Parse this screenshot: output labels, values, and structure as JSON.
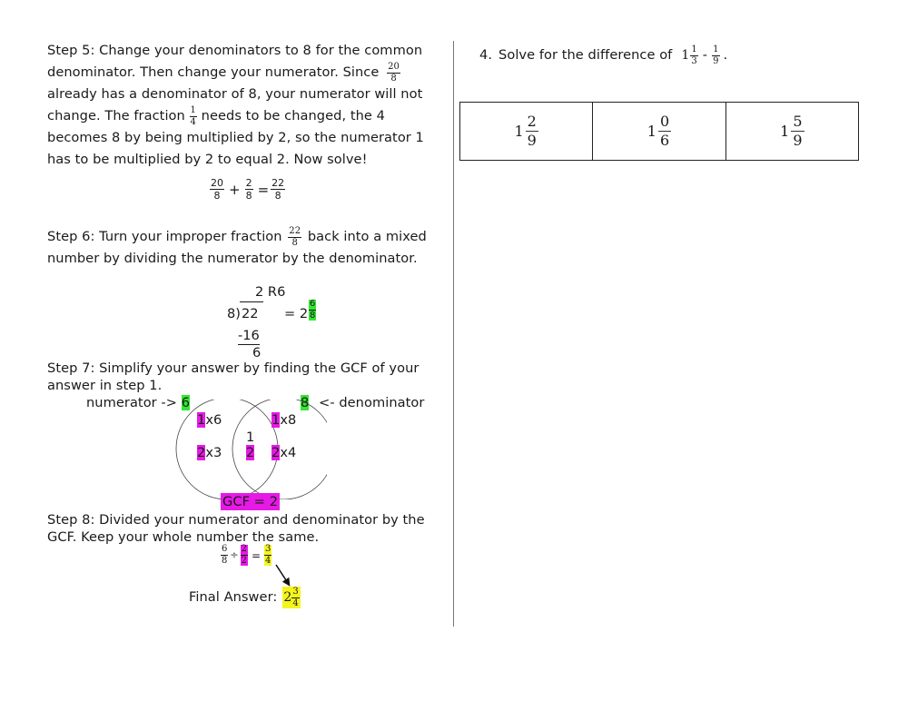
{
  "left_column": {
    "step5": {
      "line1": "Step 5: Change your denominators to 8 for the common",
      "line2_pre": "denominator. Then change your numerator. Since",
      "frac_a": {
        "num": "20",
        "den": "8"
      },
      "line3": "already has a denominator of 8, your numerator will not",
      "line4_pre": "change. The fraction",
      "frac_b": {
        "num": "1",
        "den": "4"
      },
      "line4_post": "needs to be changed, the 4",
      "line5": "becomes 8 by being multiplied by 2, so the numerator 1",
      "line6": "has to be multiplied by 2 to equal 2. Now solve!",
      "equation": {
        "a": {
          "num": "20",
          "den": "8"
        },
        "op1": "+",
        "b": {
          "num": "2",
          "den": "8"
        },
        "op2": "=",
        "c": {
          "num": "22",
          "den": "8"
        }
      }
    },
    "step6": {
      "line1_pre": "Step 6: Turn your improper fraction",
      "frac": {
        "num": "22",
        "den": "8"
      },
      "line1_post": "back into a mixed",
      "line2": "number by dividing the numerator by the denominator.",
      "division": {
        "quotient": "2 R6",
        "divisor": "8)",
        "dividend": "22",
        "equals": "= 2",
        "result_frac": {
          "num": "6",
          "den": "8"
        },
        "subtract": "-16",
        "remainder": "6"
      }
    },
    "step7": {
      "line1": "Step 7: Simplify your answer by finding the GCF of your",
      "line2": "answer in step 1.",
      "numerator_label": "numerator ->",
      "numerator_value": "6",
      "denominator_value": "8",
      "denominator_label": "<- denominator",
      "venn": {
        "left_items": [
          {
            "hl": "1",
            "rest": "x6"
          },
          {
            "hl": "2",
            "rest": "x3"
          }
        ],
        "center_items": [
          {
            "hl": "",
            "rest": "1"
          },
          {
            "hl": "2",
            "rest": ""
          }
        ],
        "right_items": [
          {
            "hl": "1",
            "rest": "x8"
          },
          {
            "hl": "2",
            "rest": "x4"
          }
        ]
      },
      "gcf_label": "GCF = 2"
    },
    "step8": {
      "line1": "Step 8: Divided your numerator and denominator by the",
      "line2": "GCF. Keep your whole number the same.",
      "equation": {
        "a": {
          "num": "6",
          "den": "8"
        },
        "op1": "÷",
        "b": {
          "num": "2",
          "den": "2"
        },
        "op2": "=",
        "c": {
          "num": "3",
          "den": "4"
        }
      },
      "final_label": "Final Answer:",
      "final_whole": "2",
      "final_frac": {
        "num": "3",
        "den": "4"
      }
    }
  },
  "right_column": {
    "question": {
      "number": "4.",
      "text": "Solve for the difference of",
      "whole": "1",
      "frac1": {
        "num": "1",
        "den": "3"
      },
      "minus": "-",
      "frac2": {
        "num": "1",
        "den": "9"
      },
      "period": "."
    },
    "choices": [
      {
        "whole": "1",
        "num": "2",
        "den": "9"
      },
      {
        "whole": "1",
        "num": "0",
        "den": "6"
      },
      {
        "whole": "1",
        "num": "5",
        "den": "9"
      }
    ]
  },
  "colors": {
    "green_highlight": "#33e633",
    "magenta_highlight": "#e619e6",
    "yellow_highlight": "#f5f51e"
  }
}
